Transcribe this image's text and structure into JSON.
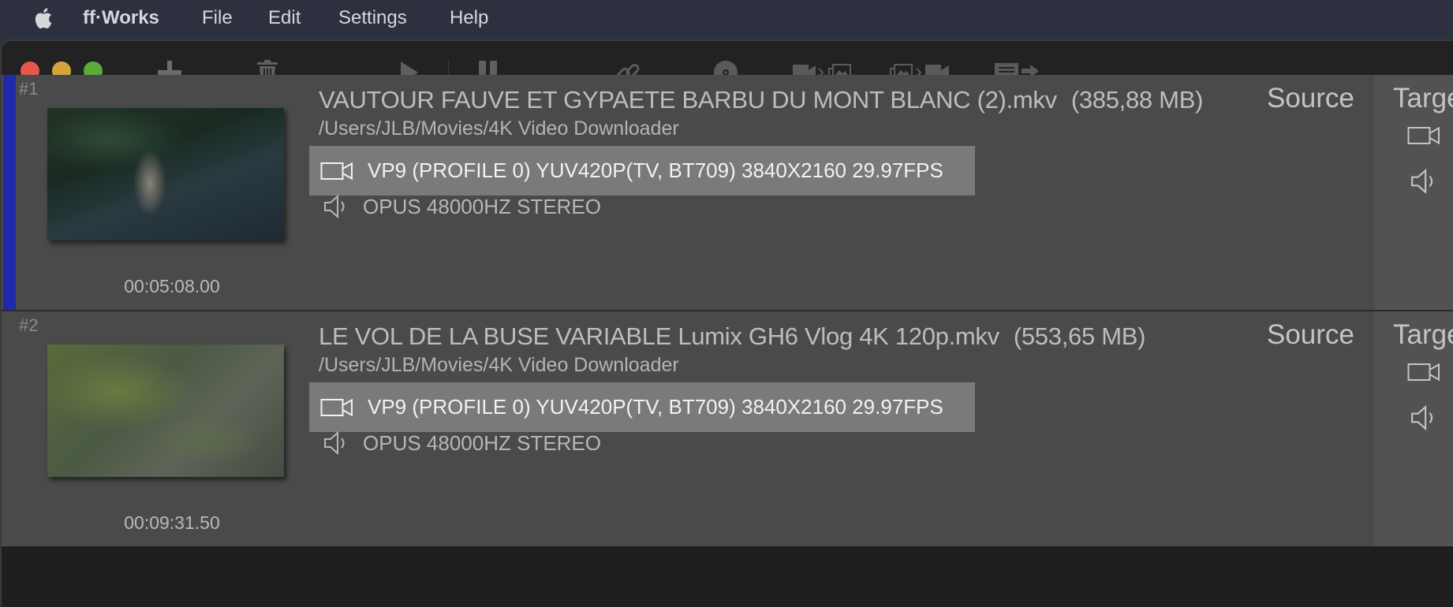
{
  "menu": {
    "app_name": "ff·Works",
    "items": [
      "File",
      "Edit",
      "Settings",
      "Help"
    ]
  },
  "toolbar": {
    "icons": [
      "plus-icon",
      "trash-icon",
      "play-icon",
      "pause-icon",
      "link-icon",
      "disc-icon",
      "video-to-images-icon",
      "images-to-video-icon",
      "subtitles-export-icon"
    ]
  },
  "colors": {
    "selection_bar": "#1f2aa8",
    "row_background": "#4a4a4a",
    "video_line_highlight": "#7a7a7a",
    "traffic_close": "#e5574b",
    "traffic_minimize": "#d4a63a",
    "traffic_maximize": "#5daa3b"
  },
  "rows": [
    {
      "index": "#1",
      "title": "VAUTOUR FAUVE ET GYPAETE BARBU DU MONT BLANC (2).mkv",
      "size": "(385,88 MB)",
      "path": "/Users/JLB/Movies/4K Video Downloader",
      "video": "VP9 (PROFILE 0)  YUV420P(TV, BT709) 3840X2160   29.97FPS",
      "audio": "OPUS 48000HZ STEREO",
      "duration": "00:05:08.00",
      "source_label": "Source",
      "target_label": "Target",
      "selected": true
    },
    {
      "index": "#2",
      "title": "LE VOL DE LA BUSE VARIABLE Lumix GH6 Vlog 4K 120p.mkv",
      "size": "(553,65 MB)",
      "path": "/Users/JLB/Movies/4K Video Downloader",
      "video": "VP9 (PROFILE 0)  YUV420P(TV, BT709) 3840X2160   29.97FPS",
      "audio": "OPUS 48000HZ STEREO",
      "duration": "00:09:31.50",
      "source_label": "Source",
      "target_label": "Target",
      "selected": false
    }
  ]
}
